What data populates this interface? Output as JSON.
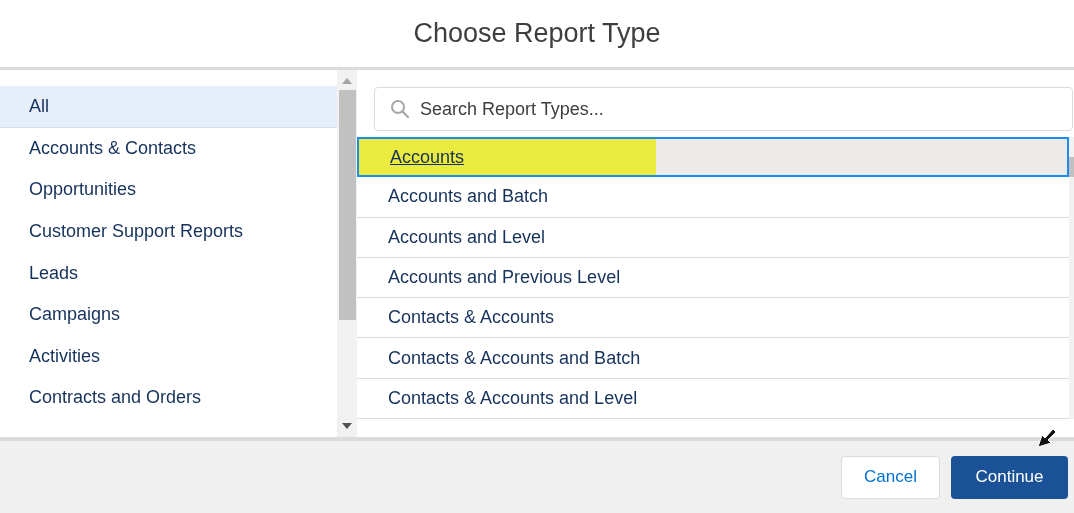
{
  "title": "Choose Report Type",
  "categories": [
    {
      "label": "All",
      "selected": true
    },
    {
      "label": "Accounts & Contacts",
      "selected": false
    },
    {
      "label": "Opportunities",
      "selected": false
    },
    {
      "label": "Customer Support Reports",
      "selected": false
    },
    {
      "label": "Leads",
      "selected": false
    },
    {
      "label": "Campaigns",
      "selected": false
    },
    {
      "label": "Activities",
      "selected": false
    },
    {
      "label": "Contracts and Orders",
      "selected": false
    }
  ],
  "search": {
    "placeholder": "Search Report Types..."
  },
  "report_types": [
    {
      "label": "Accounts",
      "selected": true,
      "highlighted": true
    },
    {
      "label": "Accounts and Batch",
      "selected": false,
      "highlighted": false
    },
    {
      "label": "Accounts and Level",
      "selected": false,
      "highlighted": false
    },
    {
      "label": "Accounts and Previous Level",
      "selected": false,
      "highlighted": false
    },
    {
      "label": "Contacts & Accounts",
      "selected": false,
      "highlighted": false
    },
    {
      "label": "Contacts & Accounts and Batch",
      "selected": false,
      "highlighted": false
    },
    {
      "label": "Contacts & Accounts and Level",
      "selected": false,
      "highlighted": false
    }
  ],
  "buttons": [
    {
      "label": "Cancel",
      "kind": "secondary"
    },
    {
      "label": "Continue",
      "kind": "primary"
    }
  ]
}
